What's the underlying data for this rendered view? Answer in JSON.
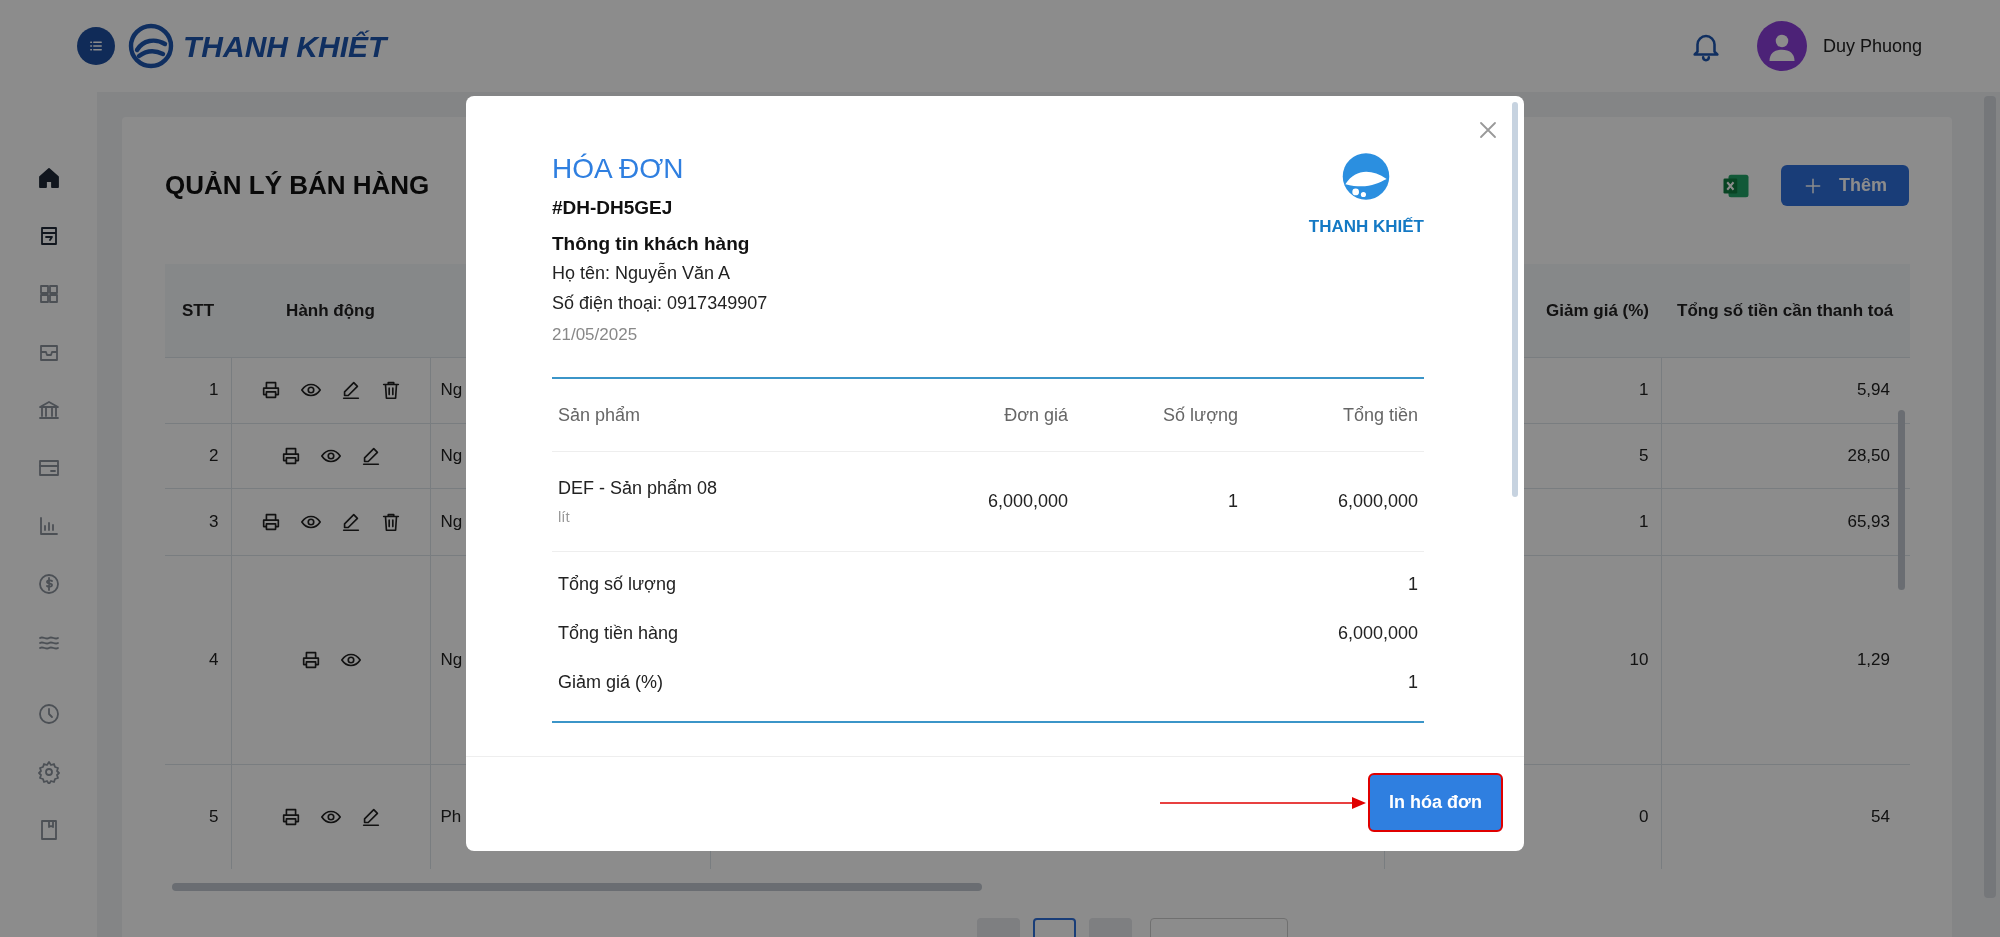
{
  "header": {
    "brand": "THANH KHIẾT",
    "user_name": "Duy Phuong"
  },
  "sidebar": {
    "items": [
      {
        "selected": true
      },
      {
        "selected": true
      },
      {
        "selected": false
      },
      {
        "selected": false
      },
      {
        "selected": false
      },
      {
        "selected": false
      },
      {
        "selected": false
      },
      {
        "selected": false
      },
      {
        "selected": false
      },
      {
        "selected": false
      },
      {
        "selected": false
      },
      {
        "selected": false
      }
    ]
  },
  "page": {
    "title": "QUẢN LÝ BÁN HÀNG",
    "add_button": "Thêm"
  },
  "table": {
    "columns": [
      "STT",
      "Hành động",
      "Giảm giá (%)",
      "Tổng số tiền cần thanh toá"
    ],
    "rows": [
      {
        "stt": "1",
        "actions": [
          {
            "kind": "print"
          },
          {
            "kind": "view"
          },
          {
            "kind": "edit"
          },
          {
            "kind": "delete"
          }
        ],
        "column_3": "Ng",
        "discount": "1",
        "total": "5,94"
      },
      {
        "stt": "2",
        "actions": [
          {
            "kind": "print"
          },
          {
            "kind": "view"
          },
          {
            "kind": "edit"
          }
        ],
        "column_3": "Ng",
        "discount": "5",
        "total": "28,50"
      },
      {
        "stt": "3",
        "actions": [
          {
            "kind": "print"
          },
          {
            "kind": "view"
          },
          {
            "kind": "edit"
          },
          {
            "kind": "delete"
          }
        ],
        "column_3": "Ng",
        "discount": "1",
        "total": "65,93"
      },
      {
        "stt": "4",
        "actions": [
          {
            "kind": "print"
          },
          {
            "kind": "view"
          }
        ],
        "column_3": "Ng",
        "discount": "10",
        "total": "1,29"
      },
      {
        "stt": "5",
        "actions": [
          {
            "kind": "print"
          },
          {
            "kind": "view"
          },
          {
            "kind": "edit"
          }
        ],
        "column_3": "Ph",
        "discount": "0",
        "total": "54"
      }
    ]
  },
  "invoice": {
    "title": "HÓA ĐƠN",
    "code": "#DH-DH5GEJ",
    "customer_heading": "Thông tin khách hàng",
    "name_line": "Họ tên: Nguyễn Văn A",
    "phone_line": "Số điện thoại: 0917349907",
    "date": "21/05/2025",
    "logo_text": "THANH KHIẾT",
    "columns": [
      "Sản phẩm",
      "Đơn giá",
      "Số lượng",
      "Tổng tiền"
    ],
    "items": [
      {
        "name": "DEF - Sản phẩm 08",
        "unit": "lít",
        "price": "6,000,000",
        "quantity": "1",
        "total": "6,000,000"
      }
    ],
    "summary": [
      {
        "label": "Tổng số lượng",
        "value": "1"
      },
      {
        "label": "Tổng tiền hàng",
        "value": "6,000,000"
      },
      {
        "label": "Giảm giá (%)",
        "value": "1"
      }
    ],
    "print_button": {
      "label": "In hóa đơn",
      "highlighted": true
    }
  }
}
